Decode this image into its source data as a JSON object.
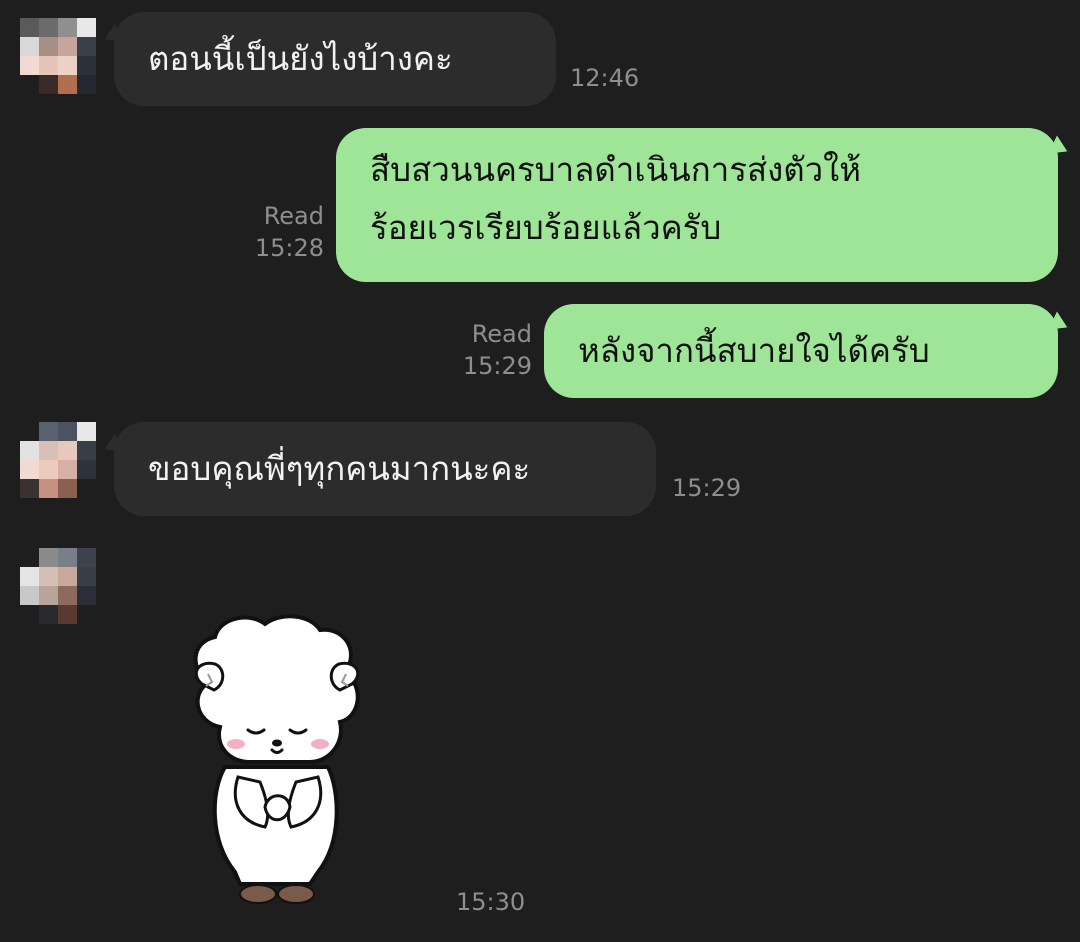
{
  "messages": [
    {
      "direction": "incoming",
      "lines": [
        "ตอนนี้เป็นยังไงบ้างคะ"
      ],
      "time": "12:46"
    },
    {
      "direction": "outgoing",
      "lines": [
        "สืบสวนนครบาลดำเนินการส่งตัวให้",
        "ร้อยเวรเรียบร้อยแล้วครับ"
      ],
      "status": "Read",
      "time": "15:28"
    },
    {
      "direction": "outgoing",
      "lines": [
        "หลังจากนี้สบายใจได้ครับ"
      ],
      "status": "Read",
      "time": "15:29"
    },
    {
      "direction": "incoming",
      "lines": [
        "ขอบคุณพี่ๆทุกคนมากนะคะ"
      ],
      "time": "15:29"
    },
    {
      "direction": "incoming",
      "sticker": "bowing-white-sheep-sticker",
      "time": "15:30"
    }
  ],
  "colors": {
    "background": "#1e1e1e",
    "incoming_bubble": "#2c2c2c",
    "outgoing_bubble": "#9ee597",
    "meta_text": "#8e8e8e"
  },
  "icons": {
    "avatar": "pixelated-avatar-icon",
    "sticker": "bowing-sheep-sticker-icon"
  }
}
